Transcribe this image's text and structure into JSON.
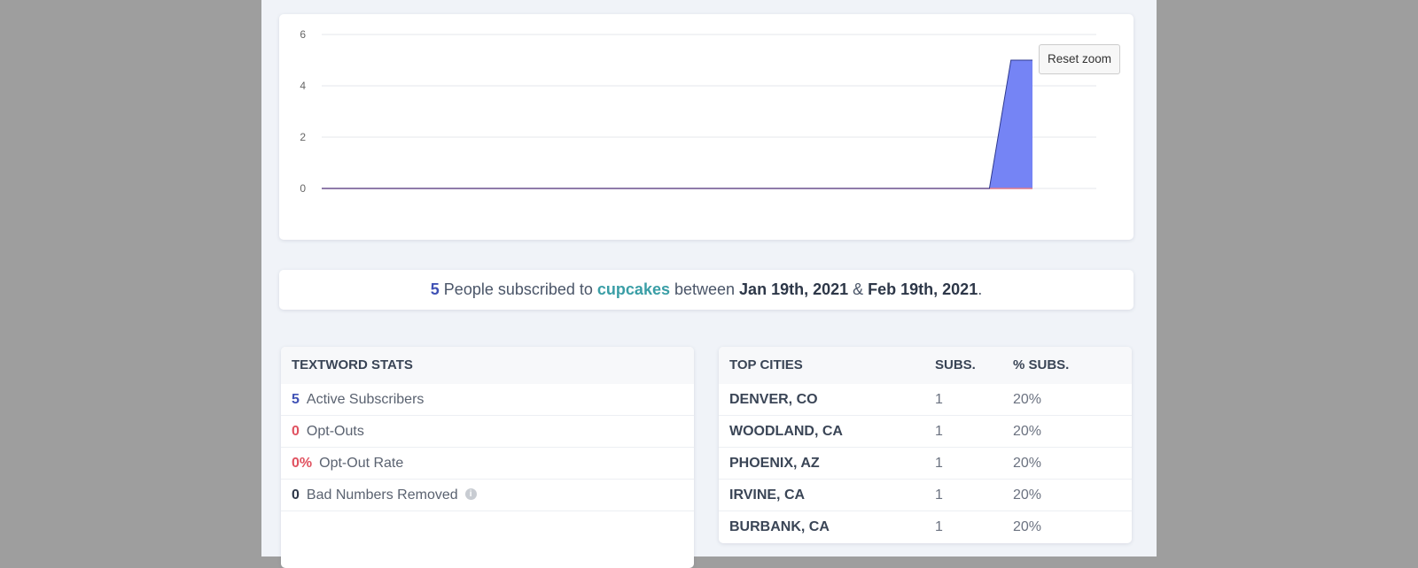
{
  "chart": {
    "reset_zoom_label": "Reset zoom",
    "colors": {
      "area_fill": "#7584f5",
      "area_line": "#2f3a8f",
      "baseline": "#e07a8a",
      "grid": "#e4e7eb"
    }
  },
  "chart_data": {
    "type": "area",
    "yticks": [
      "6",
      "4",
      "2",
      "0"
    ],
    "ylim": [
      0,
      6
    ],
    "grid": true,
    "series": [
      {
        "values": [
          0,
          0,
          0,
          0,
          0,
          0,
          0,
          0,
          0,
          0,
          0,
          0,
          0,
          0,
          0,
          0,
          0,
          0,
          0,
          0,
          0,
          0,
          0,
          0,
          0,
          0,
          0,
          0,
          0,
          0,
          0,
          0,
          5,
          5
        ]
      }
    ]
  },
  "summary": {
    "count": "5",
    "text_1": " People subscribed to ",
    "keyword": "cupcakes",
    "text_2": " between ",
    "start_date": "Jan 19th, 2021",
    "text_3": " & ",
    "end_date": "Feb 19th, 2021",
    "text_4": "."
  },
  "stats": {
    "header": "TEXTWORD STATS",
    "rows": [
      {
        "value": "5",
        "label": "Active Subscribers"
      },
      {
        "value": "0",
        "label": "Opt-Outs"
      },
      {
        "value": "0%",
        "label": "Opt-Out Rate"
      },
      {
        "value": "0",
        "label": "Bad Numbers Removed",
        "info_icon": "info-icon"
      }
    ]
  },
  "cities": {
    "headers": {
      "city": "TOP CITIES",
      "subs": "SUBS.",
      "pct": "% SUBS."
    },
    "rows": [
      {
        "city": "DENVER, CO",
        "subs": "1",
        "pct": "20%"
      },
      {
        "city": "WOODLAND, CA",
        "subs": "1",
        "pct": "20%"
      },
      {
        "city": "PHOENIX, AZ",
        "subs": "1",
        "pct": "20%"
      },
      {
        "city": "IRVINE, CA",
        "subs": "1",
        "pct": "20%"
      },
      {
        "city": "BURBANK, CA",
        "subs": "1",
        "pct": "20%"
      }
    ]
  }
}
